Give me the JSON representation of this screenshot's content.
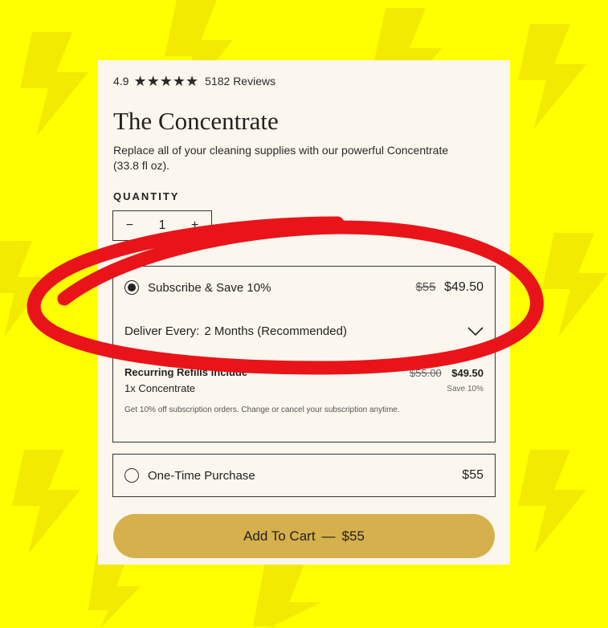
{
  "rating": {
    "score": "4.9",
    "stars": "★★★★★",
    "reviews": "5182 Reviews"
  },
  "product": {
    "title": "The Concentrate",
    "description": "Replace all of your cleaning supplies with our powerful Concentrate (33.8 fl oz)."
  },
  "quantity": {
    "label": "QUANTITY",
    "minus": "−",
    "value": "1",
    "plus": "+"
  },
  "subscribe": {
    "label": "Subscribe & Save 10%",
    "old_price": "$55",
    "price": "$49.50",
    "deliver_label": "Deliver Every:",
    "deliver_value": "2 Months (Recommended)"
  },
  "refills": {
    "title": "Recurring Refills Include",
    "item": "1x Concentrate",
    "old_price": "$55.00",
    "price": "$49.50",
    "save": "Save 10%",
    "note": "Get 10% off subscription orders. Change or cancel your subscription anytime."
  },
  "one_time": {
    "label": "One-Time Purchase",
    "price": "$55"
  },
  "cart": {
    "label": "Add To Cart",
    "separator": "—",
    "price": "$55"
  },
  "colors": {
    "background": "#ffff00",
    "card": "#fbf7ee",
    "button": "#d6b04c",
    "annotation": "#e8141a"
  },
  "icons": {
    "selected_radio": "radio-selected-icon",
    "chevron": "chevron-down-icon",
    "circle": "red-circle-annotation"
  }
}
